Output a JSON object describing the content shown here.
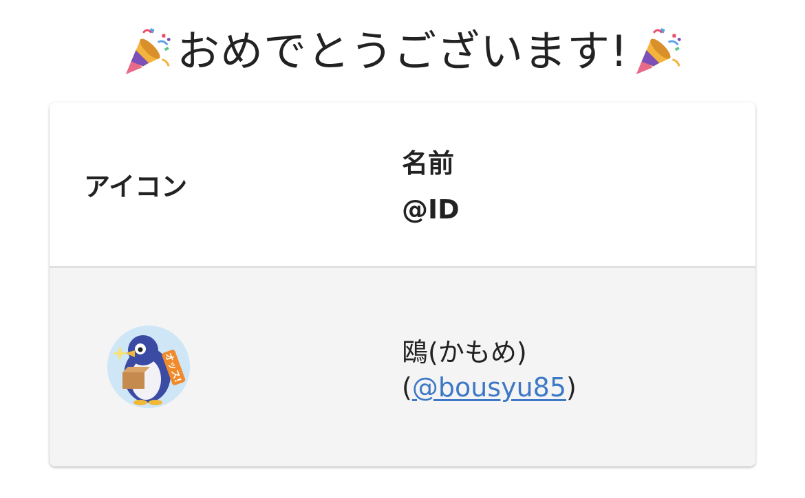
{
  "heading": {
    "text": "おめでとうございます!",
    "left_icon": "party-popper-icon",
    "right_icon": "party-popper-icon"
  },
  "table": {
    "header": {
      "icon_label": "アイコン",
      "name_label": "名前",
      "id_label": "@ID"
    },
    "rows": [
      {
        "avatar": "penguin-avatar",
        "name": "鴎(かもめ)",
        "id_open": "(",
        "id": "@bousyu85",
        "id_close": ")"
      }
    ]
  },
  "colors": {
    "link": "#3d78c7",
    "row_background": "#f4f4f4",
    "divider": "#e1e1e1"
  }
}
